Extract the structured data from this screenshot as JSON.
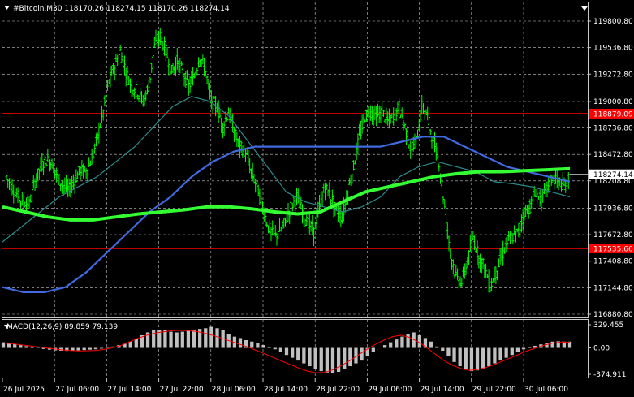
{
  "header": {
    "title": "#Bitcoin,M30 118170.26 118274.15 118170.26 118274.14"
  },
  "indicator": {
    "label": "MACD(12,26,9) 89.859 79.139"
  },
  "colors": {
    "background": "#000000",
    "grid": "#c8c8c8",
    "candles": "#00ff00",
    "level_lines": "#ff0000",
    "ma_fast": "#2e8b8b",
    "ma_mid": "#4169e1",
    "ma_slow": "#33ff33",
    "macd_hist": "#c0c0c0",
    "macd_signal": "#ff0000"
  },
  "chart_data": [
    {
      "type": "candlestick",
      "instrument": "#Bitcoin",
      "timeframe": "M30",
      "y_ticks": [
        "119800.80",
        "119536.80",
        "119272.80",
        "119000.80",
        "118736.80",
        "118472.80",
        "118208.80",
        "117936.80",
        "117672.80",
        "117408.80",
        "117144.80",
        "116880.80"
      ],
      "ylim": [
        116880.8,
        119800.8
      ],
      "x_ticks": [
        "26 Jul 2025",
        "27 Jul 06:00",
        "27 Jul 14:00",
        "27 Jul 22:00",
        "28 Jul 06:00",
        "28 Jul 14:00",
        "28 Jul 22:00",
        "29 Jul 06:00",
        "29 Jul 14:00",
        "29 Jul 22:00",
        "30 Jul 06:00"
      ],
      "horizontal_levels": [
        {
          "label": "118879.09",
          "value": 118879.09
        },
        {
          "label": "117535.66",
          "value": 117535.66
        }
      ],
      "current_price": {
        "label": "118274.14",
        "value": 118274.14
      },
      "price_path": [
        118250,
        118150,
        118050,
        118000,
        117980,
        118200,
        118350,
        118420,
        118380,
        118250,
        118150,
        118120,
        118220,
        118320,
        118300,
        118420,
        118650,
        118900,
        119200,
        119350,
        119500,
        119300,
        119150,
        119100,
        119000,
        119150,
        119550,
        119650,
        119500,
        119300,
        119400,
        119300,
        119150,
        119250,
        119450,
        119300,
        119000,
        118950,
        118750,
        118900,
        118700,
        118550,
        118500,
        118300,
        118150,
        117950,
        117750,
        117650,
        117700,
        117800,
        117950,
        118050,
        117900,
        117800,
        117700,
        117950,
        118150,
        118050,
        117900,
        117850,
        118100,
        118350,
        118650,
        118850,
        118900,
        118850,
        118900,
        118800,
        118850,
        118950,
        118750,
        118550,
        118600,
        118950,
        118850,
        118600,
        118400,
        117950,
        117500,
        117250,
        117200,
        117400,
        117650,
        117450,
        117350,
        117150,
        117300,
        117450,
        117600,
        117650,
        117700,
        117900,
        117950,
        118100,
        118000,
        118150,
        118250,
        118200,
        118150,
        118274.14
      ],
      "moving_averages": [
        {
          "color": "#2e8b8b",
          "values": [
            117600,
            117750,
            117900,
            118050,
            118150,
            118250,
            118400,
            118550,
            118750,
            118950,
            119050,
            119000,
            118850,
            118600,
            118350,
            118100,
            118000,
            117950,
            117900,
            117950,
            118050,
            118250,
            118350,
            118400,
            118350,
            118300,
            118200,
            118180,
            118150,
            118100,
            118050
          ]
        },
        {
          "color": "#4169e1",
          "values": [
            117150,
            117100,
            117100,
            117150,
            117300,
            117500,
            117700,
            117900,
            118050,
            118250,
            118400,
            118500,
            118550,
            118550,
            118550,
            118550,
            118550,
            118550,
            118550,
            118600,
            118650,
            118650,
            118550,
            118450,
            118350,
            118300,
            118250,
            118200
          ]
        },
        {
          "color": "#33ff33",
          "values": [
            117950,
            117900,
            117850,
            117820,
            117820,
            117850,
            117880,
            117900,
            117920,
            117950,
            117950,
            117930,
            117900,
            117880,
            117900,
            118000,
            118100,
            118150,
            118200,
            118250,
            118280,
            118300,
            118300,
            118310,
            118320,
            118330
          ]
        }
      ]
    },
    {
      "type": "macd",
      "label": "MACD(12,26,9) 89.859 79.139",
      "y_ticks": [
        "329.455",
        "0.00",
        "-374.911"
      ],
      "ylim": [
        -374.911,
        329.455
      ],
      "histogram": [
        80,
        70,
        55,
        40,
        25,
        10,
        -5,
        -15,
        -25,
        -35,
        -40,
        -42,
        -40,
        -35,
        -30,
        -25,
        -20,
        -10,
        5,
        20,
        40,
        60,
        90,
        130,
        180,
        220,
        250,
        260,
        250,
        230,
        220,
        230,
        250,
        260,
        270,
        280,
        300,
        280,
        250,
        200,
        160,
        140,
        110,
        90,
        70,
        40,
        10,
        -20,
        -60,
        -100,
        -140,
        -180,
        -220,
        -260,
        -300,
        -330,
        -350,
        -360,
        -340,
        -300,
        -260,
        -220,
        -180,
        -120,
        -60,
        0,
        40,
        80,
        120,
        160,
        200,
        220,
        180,
        140,
        90,
        20,
        -40,
        -120,
        -200,
        -260,
        -300,
        -330,
        -320,
        -300,
        -260,
        -220,
        -180,
        -140,
        -100,
        -60,
        -20,
        10,
        30,
        50,
        70,
        90,
        95,
        90,
        89.859
      ],
      "signal": [
        70,
        60,
        45,
        30,
        15,
        0,
        -15,
        -28,
        -38,
        -42,
        -40,
        -35,
        -20,
        5,
        40,
        90,
        140,
        180,
        210,
        230,
        245,
        250,
        245,
        230,
        205,
        170,
        130,
        90,
        50,
        10,
        -40,
        -90,
        -140,
        -190,
        -240,
        -290,
        -330,
        -355,
        -350,
        -310,
        -250,
        -180,
        -100,
        -20,
        50,
        110,
        160,
        180,
        150,
        90,
        10,
        -80,
        -170,
        -240,
        -290,
        -320,
        -310,
        -280,
        -240,
        -190,
        -140,
        -90,
        -40,
        0,
        40,
        70,
        85,
        79.139
      ]
    }
  ]
}
